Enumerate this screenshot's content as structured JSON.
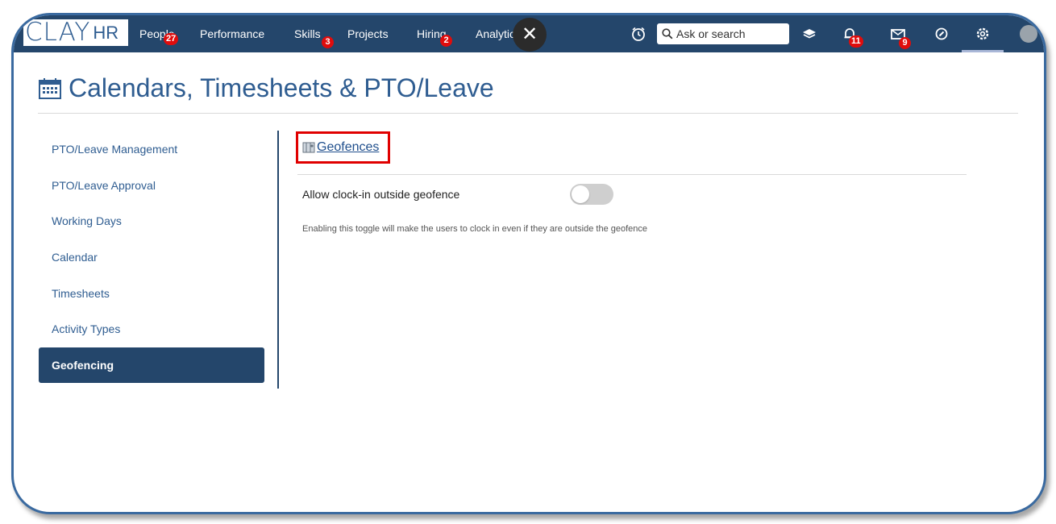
{
  "brand": {
    "logo_main": "CLAY",
    "logo_sub": "HR"
  },
  "nav": {
    "items": [
      {
        "label": "People",
        "badge": "27"
      },
      {
        "label": "Performance",
        "badge": ""
      },
      {
        "label": "Skills",
        "badge": "3"
      },
      {
        "label": "Projects",
        "badge": ""
      },
      {
        "label": "Hiring",
        "badge": "2"
      },
      {
        "label": "Analytics",
        "badge": ""
      }
    ],
    "close_symbol": "✕",
    "search_placeholder": "Ask or search",
    "notifications_badge": "11",
    "messages_badge": "9",
    "icons": [
      "alarm-clock-icon",
      "layers-icon",
      "bell-icon",
      "envelope-icon",
      "help-icon",
      "gear-icon"
    ]
  },
  "page": {
    "title": "Calendars, Timesheets & PTO/Leave"
  },
  "sidebar": {
    "items": [
      {
        "label": "PTO/Leave Management",
        "active": false
      },
      {
        "label": "PTO/Leave Approval",
        "active": false
      },
      {
        "label": "Working Days",
        "active": false
      },
      {
        "label": "Calendar",
        "active": false
      },
      {
        "label": "Timesheets",
        "active": false
      },
      {
        "label": "Activity Types",
        "active": false
      },
      {
        "label": "Geofencing",
        "active": true
      }
    ]
  },
  "main": {
    "section_link": "Geofences",
    "toggle_label": "Allow clock-in outside geofence",
    "toggle_on": false,
    "help_text": "Enabling this toggle will make the users to clock in even if they are outside the geofence"
  },
  "colors": {
    "nav_bg": "#24466b",
    "accent": "#2f5d91",
    "badge": "#e00c0c",
    "highlight_box": "#e00000"
  }
}
